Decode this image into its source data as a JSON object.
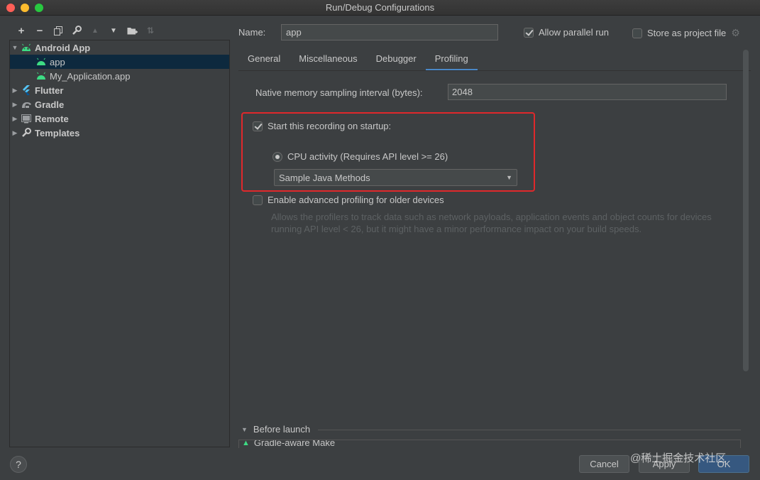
{
  "window": {
    "title": "Run/Debug Configurations"
  },
  "tree": {
    "items": [
      {
        "label": "Android App",
        "expanded": true
      },
      {
        "label": "app"
      },
      {
        "label": "My_Application.app"
      },
      {
        "label": "Flutter"
      },
      {
        "label": "Gradle"
      },
      {
        "label": "Remote"
      },
      {
        "label": "Templates"
      }
    ]
  },
  "config": {
    "name_label": "Name:",
    "name_value": "app",
    "allow_parallel_label": "Allow parallel run",
    "allow_parallel_checked": true,
    "store_project_label": "Store as project file",
    "store_project_checked": false
  },
  "tabs": [
    {
      "label": "General"
    },
    {
      "label": "Miscellaneous"
    },
    {
      "label": "Debugger"
    },
    {
      "label": "Profiling",
      "active": true
    }
  ],
  "profiling": {
    "mem_label": "Native memory sampling interval (bytes):",
    "mem_value": "2048",
    "start_recording_label": "Start this recording on startup:",
    "start_recording_checked": true,
    "cpu_label": "CPU activity (Requires API level >= 26)",
    "cpu_selected": true,
    "method_value": "Sample Java Methods",
    "advanced_label": "Enable advanced profiling for older devices",
    "advanced_checked": false,
    "advanced_desc": "Allows the profilers to track data such as network payloads, application events and object counts for devices running API level < 26, but it might have a minor performance impact on your build speeds."
  },
  "before_launch": {
    "label": "Before launch",
    "items": [
      {
        "label": "Gradle-aware Make"
      }
    ]
  },
  "footer": {
    "help": "?",
    "cancel": "Cancel",
    "apply": "Apply",
    "ok": "OK"
  },
  "watermark": "@稀土掘金技术社区",
  "colors": {
    "accent": "#4a88c7",
    "highlight": "#e0282b",
    "selection": "#0d293e",
    "android_green": "#3ddc84"
  }
}
